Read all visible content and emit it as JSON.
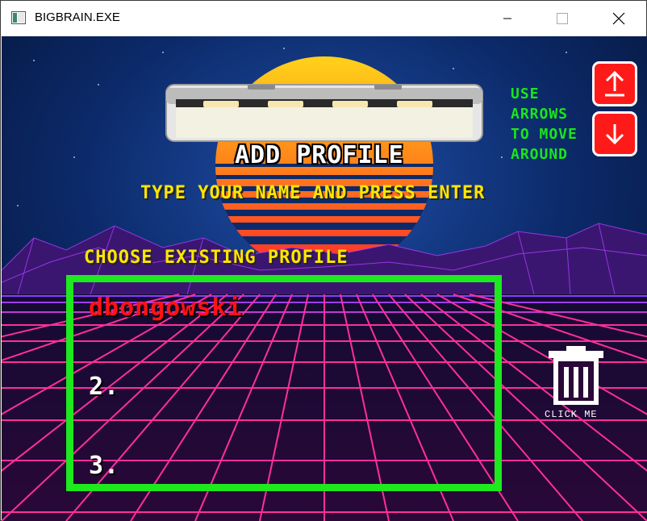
{
  "window": {
    "title": "BIGBRAIN.EXE",
    "controls": {
      "minimize": "minimize-icon",
      "maximize": "maximize-icon",
      "close": "close-icon"
    }
  },
  "screen": {
    "header": {
      "title": "ADD PROFILE",
      "instruction": "TYPE YOUR NAME AND PRESS ENTER"
    },
    "existing": {
      "label": "CHOOSE EXISTING PROFILE",
      "slots": [
        {
          "label": "dbongowski",
          "selected": true
        },
        {
          "label": "2."
        },
        {
          "label": "3."
        }
      ]
    },
    "navigation": {
      "hint_lines": [
        "USE",
        "ARROWS",
        "TO MOVE",
        "AROUND"
      ],
      "up_icon": "arrow-up-icon",
      "down_icon": "arrow-down-icon"
    },
    "delete": {
      "icon": "trash-icon",
      "label": "CLICK ME"
    }
  },
  "colors": {
    "accent_green": "#1ee81e",
    "title_yellow": "#ffe600",
    "selected_red": "#ff1212",
    "arrow_button_red": "#ff1a1a"
  }
}
